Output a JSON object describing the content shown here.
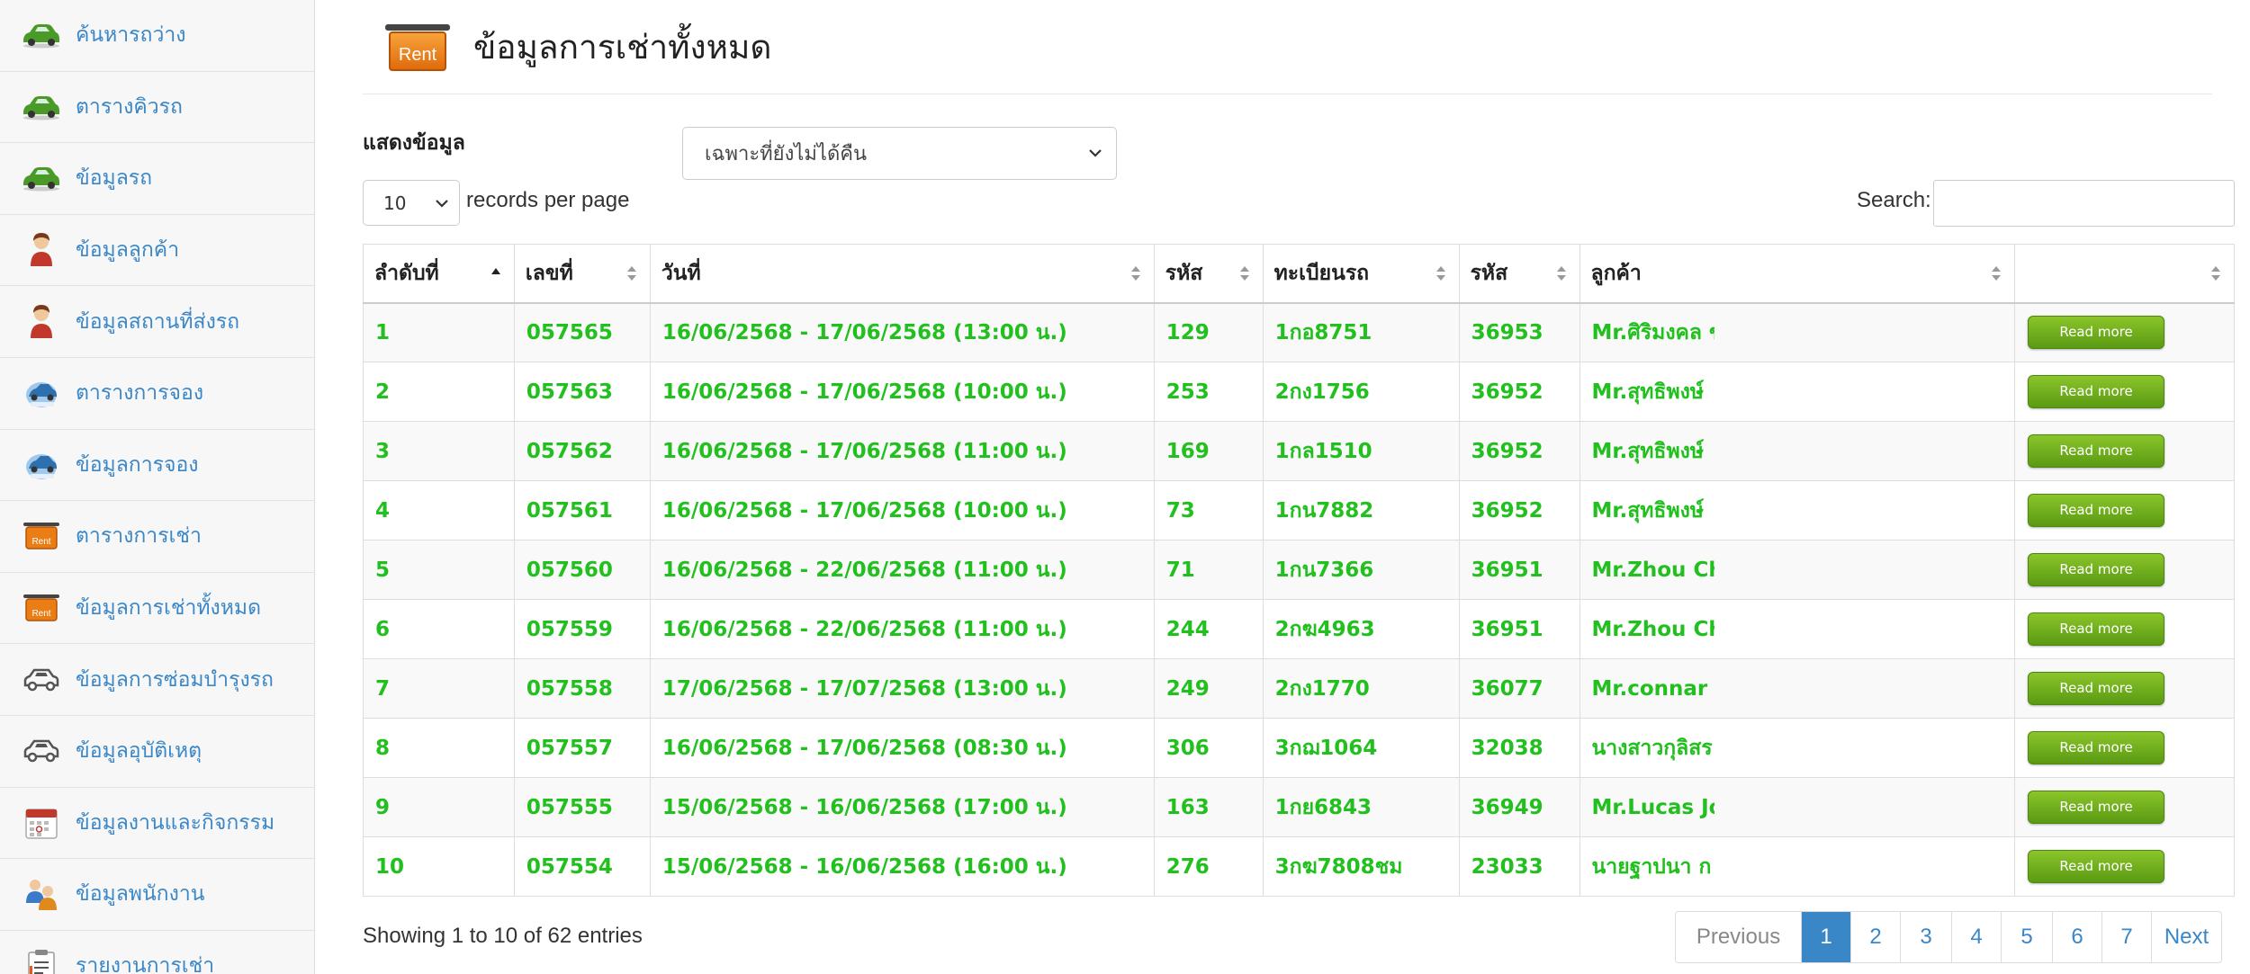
{
  "sidebar": {
    "items": [
      {
        "label": "ค้นหารถว่าง",
        "icon": "green-car-icon"
      },
      {
        "label": "ตารางคิวรถ",
        "icon": "green-car-icon"
      },
      {
        "label": "ข้อมูลรถ",
        "icon": "green-car-icon"
      },
      {
        "label": "ข้อมูลลูกค้า",
        "icon": "customer-icon"
      },
      {
        "label": "ข้อมูลสถานที่ส่งรถ",
        "icon": "customer-icon"
      },
      {
        "label": "ตารางการจอง",
        "icon": "booking-icon"
      },
      {
        "label": "ข้อมูลการจอง",
        "icon": "booking-icon"
      },
      {
        "label": "ตารางการเช่า",
        "icon": "rent-icon"
      },
      {
        "label": "ข้อมูลการเช่าทั้งหมด",
        "icon": "rent-icon"
      },
      {
        "label": "ข้อมูลการซ่อมบำรุงรถ",
        "icon": "car-outline-icon"
      },
      {
        "label": "ข้อมูลอุบัติเหตุ",
        "icon": "car-outline-icon"
      },
      {
        "label": "ข้อมูลงานและกิจกรรม",
        "icon": "calendar-icon"
      },
      {
        "label": "ข้อมูลพนักงาน",
        "icon": "staff-icon"
      },
      {
        "label": "รายงานการเช่า",
        "icon": "report-icon"
      }
    ]
  },
  "header": {
    "badge": "Rent",
    "title": "ข้อมูลการเช่าทั้งหมด"
  },
  "filter": {
    "label": "แสดงข้อมูล",
    "selected": "เฉพาะที่ยังไม่ได้คืน"
  },
  "length": {
    "value": "10",
    "suffix": "records per page"
  },
  "search": {
    "label": "Search:",
    "value": ""
  },
  "table": {
    "headers": [
      "ลำดับที่",
      "เลขที่",
      "วันที่",
      "รหัส",
      "ทะเบียนรถ",
      "รหัส",
      "ลูกค้า",
      ""
    ],
    "rows": [
      {
        "no": "1",
        "doc": "057565",
        "date": "16/06/2568 - 17/06/2568 (13:00 น.)",
        "code": "129",
        "plate": "1กอ8751",
        "cust_code": "36953",
        "customer": "Mr.ศิริมงคล ข",
        "action": "Read more"
      },
      {
        "no": "2",
        "doc": "057563",
        "date": "16/06/2568 - 17/06/2568 (10:00 น.)",
        "code": "253",
        "plate": "2กง1756",
        "cust_code": "36952",
        "customer": "Mr.สุทธิพงษ์",
        "action": "Read more"
      },
      {
        "no": "3",
        "doc": "057562",
        "date": "16/06/2568 - 17/06/2568 (11:00 น.)",
        "code": "169",
        "plate": "1กล1510",
        "cust_code": "36952",
        "customer": "Mr.สุทธิพงษ์",
        "action": "Read more"
      },
      {
        "no": "4",
        "doc": "057561",
        "date": "16/06/2568 - 17/06/2568 (10:00 น.)",
        "code": "73",
        "plate": "1กน7882",
        "cust_code": "36952",
        "customer": "Mr.สุทธิพงษ์",
        "action": "Read more"
      },
      {
        "no": "5",
        "doc": "057560",
        "date": "16/06/2568 - 22/06/2568 (11:00 น.)",
        "code": "71",
        "plate": "1กน7366",
        "cust_code": "36951",
        "customer": "Mr.Zhou Chu",
        "action": "Read more"
      },
      {
        "no": "6",
        "doc": "057559",
        "date": "16/06/2568 - 22/06/2568 (11:00 น.)",
        "code": "244",
        "plate": "2กฆ4963",
        "cust_code": "36951",
        "customer": "Mr.Zhou Chu",
        "action": "Read more"
      },
      {
        "no": "7",
        "doc": "057558",
        "date": "17/06/2568 - 17/07/2568 (13:00 น.)",
        "code": "249",
        "plate": "2กง1770",
        "cust_code": "36077",
        "customer": "Mr.connar ta",
        "action": "Read more"
      },
      {
        "no": "8",
        "doc": "057557",
        "date": "16/06/2568 - 17/06/2568 (08:30 น.)",
        "code": "306",
        "plate": "3กฌ1064",
        "cust_code": "32038",
        "customer": "นางสาวกุลิสร",
        "action": "Read more"
      },
      {
        "no": "9",
        "doc": "057555",
        "date": "15/06/2568 - 16/06/2568 (17:00 น.)",
        "code": "163",
        "plate": "1กย6843",
        "cust_code": "36949",
        "customer": "Mr.Lucas Jo",
        "action": "Read more"
      },
      {
        "no": "10",
        "doc": "057554",
        "date": "15/06/2568 - 16/06/2568 (16:00 น.)",
        "code": "276",
        "plate": "3กฆ7808ชม",
        "cust_code": "23033",
        "customer": "นายฐาปนา ก",
        "action": "Read more"
      }
    ]
  },
  "info": "Showing 1 to 10 of 62 entries",
  "pagination": {
    "pages": [
      "Previous",
      "1",
      "2",
      "3",
      "4",
      "5",
      "6",
      "7",
      "Next"
    ],
    "active": "1"
  },
  "colors": {
    "link": "#3a87c8",
    "row_text": "#22c01e",
    "button": "#6eab1c",
    "rent_orange": "#e06c0c"
  }
}
